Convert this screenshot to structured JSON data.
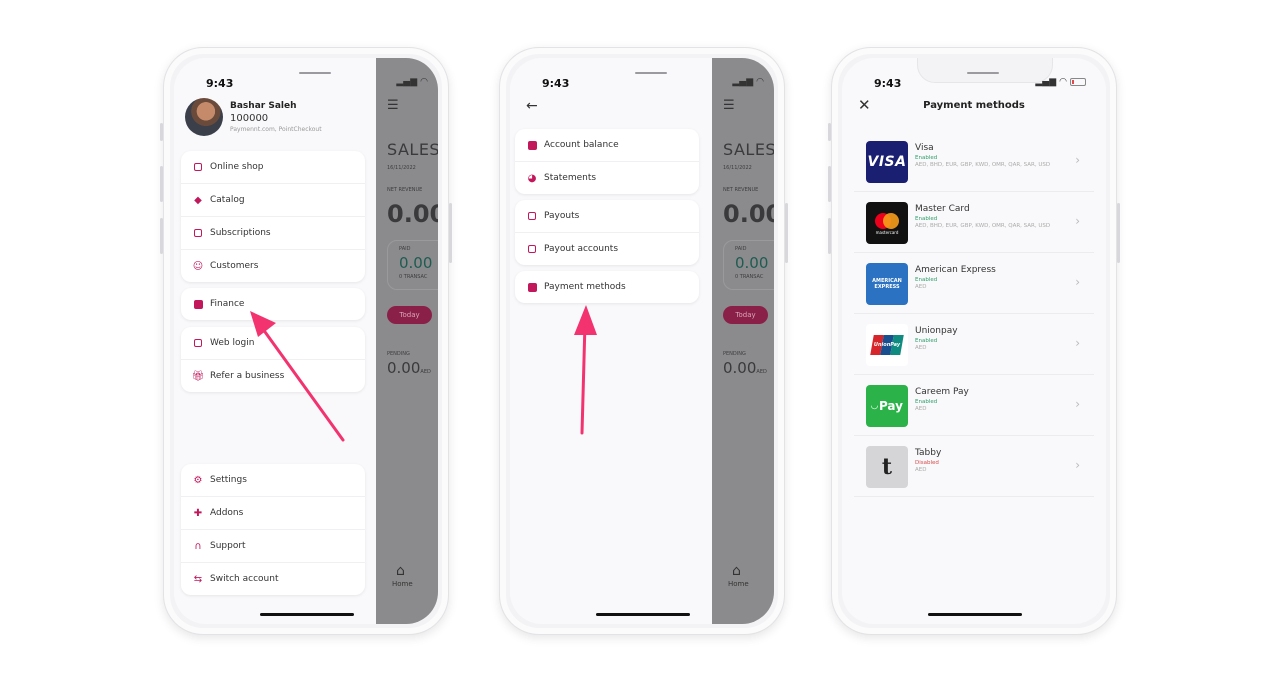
{
  "status_bar": {
    "time": "9:43"
  },
  "screen1": {
    "profile": {
      "name": "Bashar Saleh",
      "id": "100000",
      "subtitle": "Paymennt.com, PointCheckout"
    },
    "groups": [
      [
        {
          "label": "Online shop",
          "icon": "shop-icon"
        },
        {
          "label": "Catalog",
          "icon": "tag-icon"
        },
        {
          "label": "Subscriptions",
          "icon": "subscriptions-icon"
        },
        {
          "label": "Customers",
          "icon": "users-icon"
        }
      ],
      [
        {
          "label": "Finance",
          "icon": "finance-icon"
        }
      ],
      [
        {
          "label": "Web login",
          "icon": "laptop-icon"
        },
        {
          "label": "Refer a business",
          "icon": "gift-icon"
        }
      ],
      [
        {
          "label": "Settings",
          "icon": "gear-icon"
        },
        {
          "label": "Addons",
          "icon": "puzzle-icon"
        },
        {
          "label": "Support",
          "icon": "headphones-icon"
        },
        {
          "label": "Switch account",
          "icon": "switch-icon"
        }
      ]
    ]
  },
  "dashboard_bg": {
    "sales": "SALES",
    "date": "16/11/2022",
    "net_revenue_label": "NET REVENUE",
    "net_revenue_value": "0.00",
    "paid_label": "PAID",
    "paid_value": "0.00",
    "transactions_label": "0 TRANSAC",
    "today": "Today",
    "pending_label": "PENDING",
    "pending_value": "0.00",
    "pending_unit": "AED",
    "home": "Home"
  },
  "screen2": {
    "groups": [
      [
        {
          "label": "Account balance",
          "icon": "register-icon"
        },
        {
          "label": "Statements",
          "icon": "pie-chart-icon"
        }
      ],
      [
        {
          "label": "Payouts",
          "icon": "payout-icon"
        },
        {
          "label": "Payout accounts",
          "icon": "payout-account-icon"
        }
      ],
      [
        {
          "label": "Payment methods",
          "icon": "payment-methods-icon"
        }
      ]
    ]
  },
  "screen3": {
    "title": "Payment methods",
    "methods": [
      {
        "name": "Visa",
        "status": "Enabled",
        "currencies": "AED, BHD, EUR, GBP, KWD, OMR, QAR, SAR, USD",
        "logo": "VISA"
      },
      {
        "name": "Master Card",
        "status": "Enabled",
        "currencies": "AED, BHD, EUR, GBP, KWD, OMR, QAR, SAR, USD",
        "logo": "mastercard"
      },
      {
        "name": "American Express",
        "status": "Enabled",
        "currencies": "AED",
        "logo": "AMERICAN EXPRESS"
      },
      {
        "name": "Unionpay",
        "status": "Enabled",
        "currencies": "AED",
        "logo": "UnionPay"
      },
      {
        "name": "Careem Pay",
        "status": "Enabled",
        "currencies": "AED",
        "logo": "Pay"
      },
      {
        "name": "Tabby",
        "status": "Disabled",
        "currencies": "AED",
        "logo": "t"
      }
    ]
  },
  "colors": {
    "accent": "#c2185b",
    "arrow": "#f2336f",
    "enabled": "#2e9e6a",
    "disabled": "#d64a4a"
  }
}
